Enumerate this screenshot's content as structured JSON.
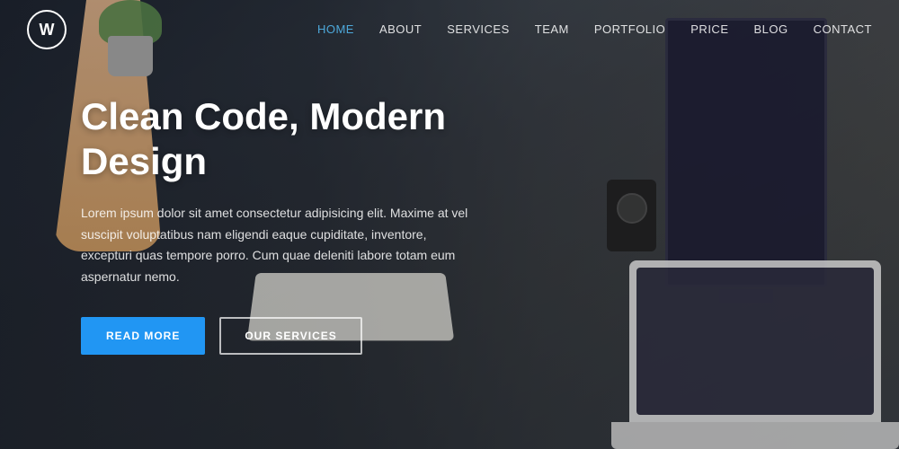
{
  "logo": {
    "symbol": "W"
  },
  "nav": {
    "items": [
      {
        "label": "HOME",
        "active": true
      },
      {
        "label": "ABOUT",
        "active": false
      },
      {
        "label": "SERVICES",
        "active": false
      },
      {
        "label": "TEAM",
        "active": false
      },
      {
        "label": "PORTFOLIO",
        "active": false
      },
      {
        "label": "PRICE",
        "active": false
      },
      {
        "label": "BLOG",
        "active": false
      },
      {
        "label": "CONTACT",
        "active": false
      }
    ]
  },
  "hero": {
    "title": "Clean Code, Modern Design",
    "description": "Lorem ipsum dolor sit amet consectetur adipisicing elit. Maxime at vel suscipit voluptatibus nam eligendi eaque cupiditate, inventore, excepturi quas tempore porro. Cum quae deleniti labore totam eum aspernatur nemo.",
    "btn_primary": "READ MORE",
    "btn_secondary": "OUR SERVICES"
  }
}
